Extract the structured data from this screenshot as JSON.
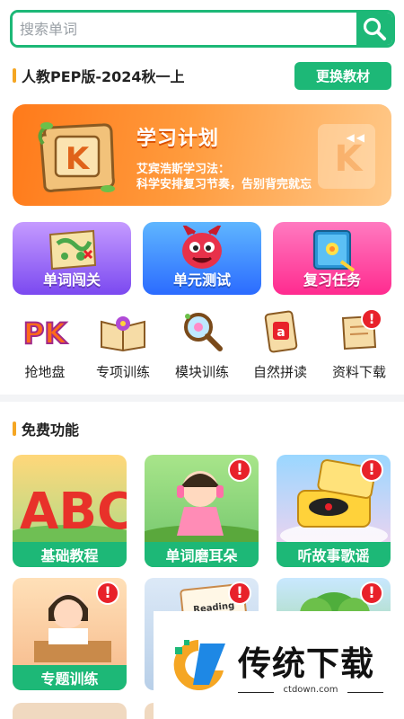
{
  "search": {
    "placeholder": "搜索单词"
  },
  "book": {
    "title": "人教PEP版-2024秋一上",
    "change_label": "更换教材"
  },
  "plan_banner": {
    "title": "学习计划",
    "line1": "艾宾浩斯学习法：",
    "line2": "科学安排复习节奏，告别背完就忘",
    "icon_letter": "K"
  },
  "feature_cards": [
    {
      "label": "单词闯关",
      "icon": "treasure-map-icon"
    },
    {
      "label": "单元测试",
      "icon": "monster-icon"
    },
    {
      "label": "复习任务",
      "icon": "book-icon"
    }
  ],
  "tools": [
    {
      "label": "抢地盘",
      "icon": "pk-icon",
      "badge": ""
    },
    {
      "label": "专项训练",
      "icon": "open-book-icon",
      "badge": ""
    },
    {
      "label": "模块训练",
      "icon": "magnifier-icon",
      "badge": ""
    },
    {
      "label": "自然拼读",
      "icon": "letter-card-icon",
      "badge": "a"
    },
    {
      "label": "资料下载",
      "icon": "scroll-icon",
      "badge": "!"
    }
  ],
  "free_section": {
    "title": "免费功能"
  },
  "free_items": [
    {
      "label": "基础教程",
      "image_text": "ABC",
      "locked": false
    },
    {
      "label": "单词磨耳朵",
      "image_text": "",
      "locked": true
    },
    {
      "label": "听故事歌谣",
      "image_text": "",
      "locked": true
    },
    {
      "label": "专题训练",
      "image_text": "",
      "locked": true
    },
    {
      "label": "",
      "image_text": "Reading",
      "locked": true
    },
    {
      "label": "",
      "image_text": "",
      "locked": true
    }
  ],
  "ad": {
    "brand": "传统下载",
    "domain": "ctdown.com"
  },
  "colors": {
    "primary": "#1db877",
    "accent": "#f5a623",
    "alert": "#e8212a"
  }
}
